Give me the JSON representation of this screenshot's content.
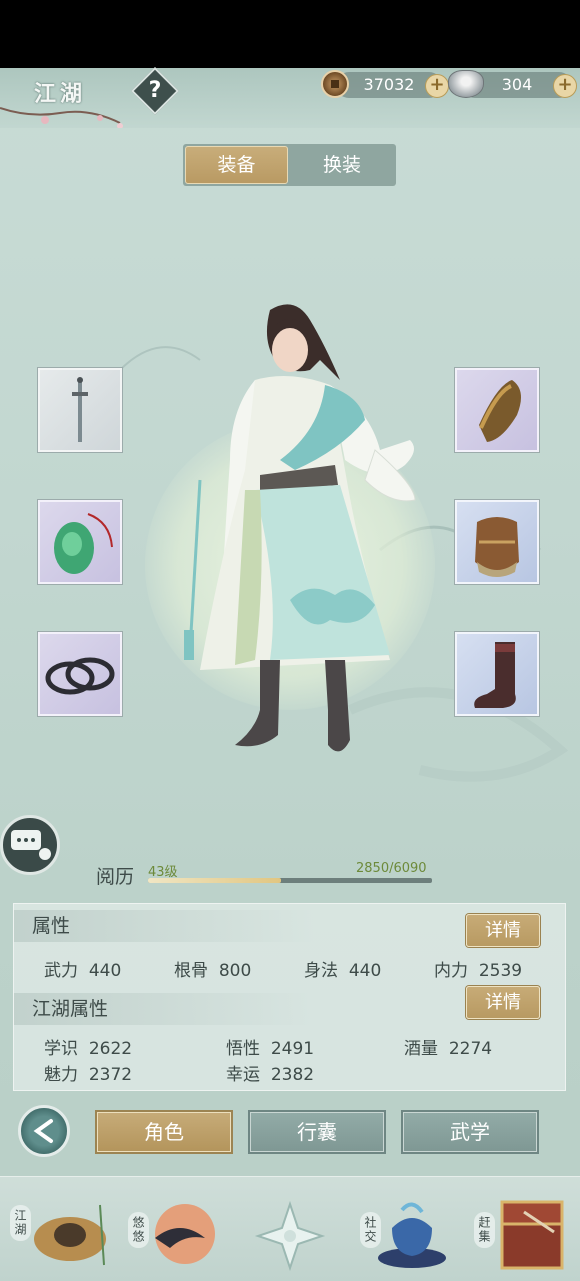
{
  "header": {
    "title": "江湖",
    "help_label": "?",
    "currencies": [
      {
        "icon": "copper-coin-icon",
        "value": "37032"
      },
      {
        "icon": "silver-ingot-icon",
        "value": "304"
      }
    ],
    "add_label": "+"
  },
  "tabs": {
    "equip": "装备",
    "outfit": "换装"
  },
  "equipment": {
    "left": [
      "sword-icon",
      "jade-pendant-icon",
      "bracelet-icon"
    ],
    "right": [
      "bracer-icon",
      "armor-icon",
      "boots-icon"
    ]
  },
  "experience": {
    "label": "阅历",
    "level": "43级",
    "value": "2850/6090",
    "progress": 0.468
  },
  "attributes": {
    "title": "属性",
    "detail_label": "详情",
    "items": [
      {
        "name": "武力",
        "value": "440"
      },
      {
        "name": "根骨",
        "value": "800"
      },
      {
        "name": "身法",
        "value": "440"
      },
      {
        "name": "内力",
        "value": "2539"
      }
    ]
  },
  "jianghu_attributes": {
    "title": "江湖属性",
    "detail_label": "详情",
    "items": [
      {
        "name": "学识",
        "value": "2622"
      },
      {
        "name": "悟性",
        "value": "2491"
      },
      {
        "name": "酒量",
        "value": "2274"
      },
      {
        "name": "魅力",
        "value": "2372"
      },
      {
        "name": "幸运",
        "value": "2382"
      }
    ]
  },
  "bottom_tabs": [
    "角色",
    "行囊",
    "武学"
  ],
  "footer": {
    "labels": [
      "江湖",
      "悠悠",
      "社交",
      "赶集"
    ]
  },
  "colors": {
    "gold": "#c3a670",
    "slate": "#7f9894",
    "bg": "#c2d7d0"
  }
}
